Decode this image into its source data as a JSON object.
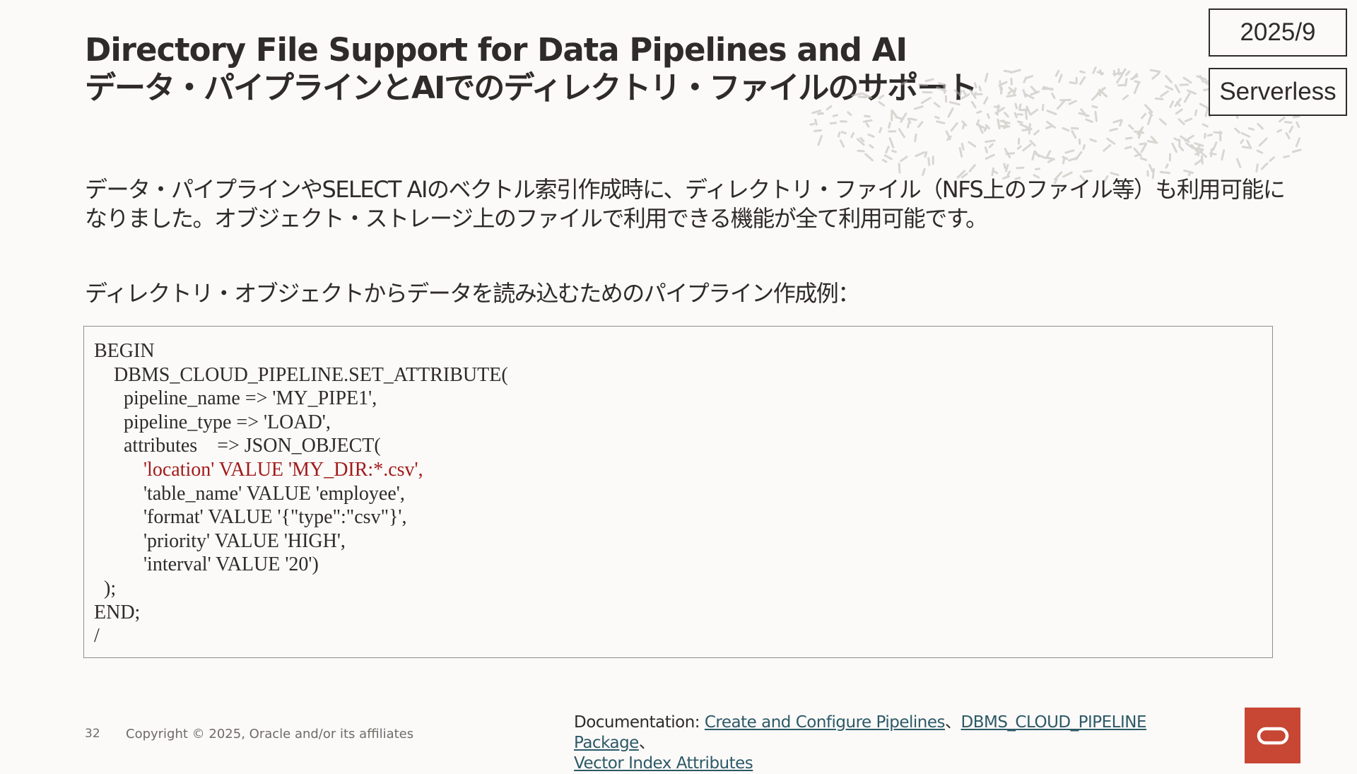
{
  "title": {
    "en": "Directory File Support for Data Pipelines and AI",
    "jp": "データ・パイプラインとAIでのディレクトリ・ファイルのサポート"
  },
  "badges": {
    "date": "2025/9",
    "type": "Serverless"
  },
  "description": "データ・パイプラインやSELECT AIのベクトル索引作成時に、ディレクトリ・ファイル（NFS上のファイル等）も利用可能になりました。オブジェクト・ストレージ上のファイルで利用できる機能が全て利用可能です。",
  "subheading": "ディレクトリ・オブジェクトからデータを読み込むためのパイプライン作成例：",
  "code": {
    "lines": [
      "BEGIN",
      "    DBMS_CLOUD_PIPELINE.SET_ATTRIBUTE(",
      "      pipeline_name => 'MY_PIPE1',",
      "      pipeline_type => 'LOAD',",
      "      attributes    => JSON_OBJECT(",
      "          'location' VALUE 'MY_DIR:*.csv',",
      "          'table_name' VALUE 'employee',",
      "          'format' VALUE '{\"type\":\"csv\"}',",
      "          'priority' VALUE 'HIGH',",
      "          'interval' VALUE '20')",
      "  );",
      "END;",
      "/"
    ],
    "highlight_color": "#a11a1a"
  },
  "footer": {
    "page_number": "32",
    "copyright": "Copyright © 2025, Oracle and/or its affiliates",
    "doc_label": "Documentation: ",
    "links": [
      "Create and Configure Pipelines",
      "DBMS_CLOUD_PIPELINE Package",
      "Vector Index Attributes"
    ],
    "separator": "、"
  },
  "colors": {
    "background": "#fbfaf8",
    "text": "#2e2b28",
    "link": "#2d5967",
    "brand_red": "#c74634"
  },
  "logo": {
    "icon": "oracle-logo-icon"
  }
}
